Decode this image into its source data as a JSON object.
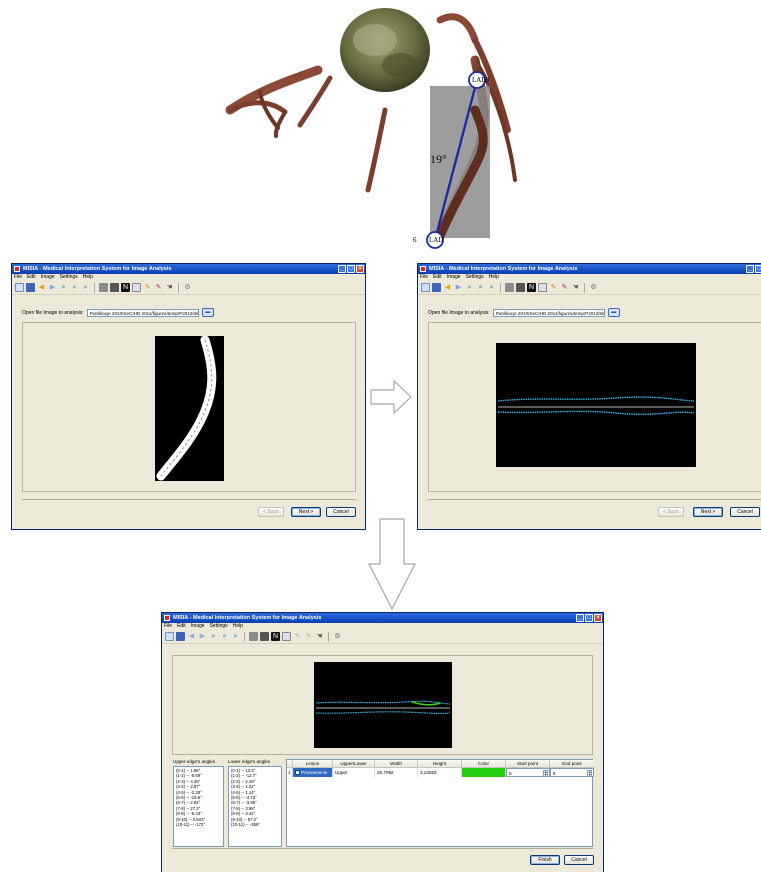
{
  "artery_figure": {
    "label_top": "LAD",
    "label_top_num": "3",
    "label_bottom": "LAD",
    "label_bottom_num": "6",
    "angle_text": "19°"
  },
  "app": {
    "title": "MISIA - Medical Interpretation System for Image Analysis",
    "menu": [
      "File",
      "Edit",
      "Image",
      "Settings",
      "Help"
    ],
    "toolbar_icons": [
      "new-file-icon",
      "save-icon",
      "back-arrow-icon",
      "forward-arrow-icon",
      "zoom-icon",
      "zoom-in-icon",
      "zoom-out-icon",
      "print-icon",
      "image-tool-icon",
      "negative-icon",
      "grid-icon",
      "pencil-icon",
      "eraser-icon",
      "hand-icon",
      "settings-gear-icon"
    ]
  },
  "step1": {
    "open_label": "Open file Image to analysis:",
    "path": "Publikacje 2010/SeCIHD 2011/figures/temp/PJ012/tetnica.tif",
    "back": "< Back",
    "next": "Next >",
    "cancel": "Cancel"
  },
  "step2": {
    "open_label": "Open file Image to analysis:",
    "path": "Publikacje 2010/SeCIHD 2011/figures/temp/PJ012/tetnica.tif",
    "back": "< Back",
    "next": "Next >",
    "cancel": "Cancel"
  },
  "step3": {
    "upper_title": "Upper edge's angles",
    "lower_title": "Lower edge's angles",
    "upper_angles": [
      "(0-1) -- 1.86°",
      "(1-2) -- -5.69°",
      "(2-3) -- 4.29°",
      "(3-4) -- 2.87°",
      "(4-5) -- -2.28°",
      "(5-6) -- -15.6°",
      "(6-7) -- 2.84°",
      "(7-8) -- 27.3°",
      "(8-9) -- -6.43°",
      "(9-10) -- 0.933°",
      "(10-11) -- -172°"
    ],
    "lower_angles": [
      "(0-1) -- 12.3°",
      "(1-2) -- -12.7°",
      "(2-3) -- 2.28°",
      "(3-4) -- 1.02°",
      "(4-5) -- 1.14°",
      "(5-6) -- -4.73°",
      "(6-7) -- -3.88°",
      "(7-8) -- 3.98°",
      "(8-9) -- 3.42°",
      "(9-10) -- 57.2°",
      "(10-11) -- -359°"
    ],
    "columns": [
      "Lesion",
      "Upper/Lower",
      "Width",
      "Height",
      "Color",
      "Start point",
      "End point"
    ],
    "rows": [
      {
        "num": "1",
        "lesion": "Przewezenie",
        "side": "Upper",
        "width": "26.7092",
        "height": "3.23653",
        "color": "#22cc11",
        "start": "5",
        "end": "8"
      }
    ],
    "finish": "Finish",
    "cancel": "Cancel"
  }
}
